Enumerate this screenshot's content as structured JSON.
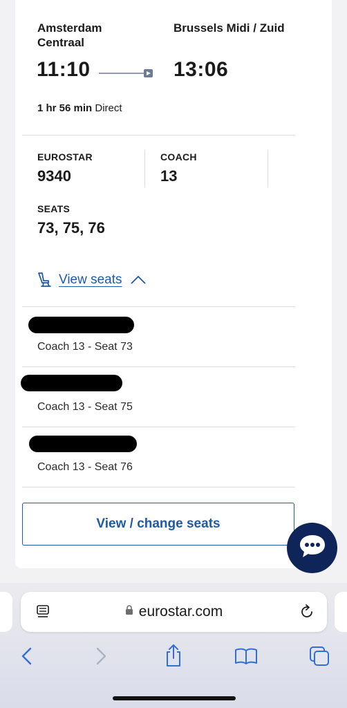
{
  "journey": {
    "origin": "Amsterdam Centraal",
    "destination": "Brussels Midi / Zuid",
    "departure_time": "11:10",
    "arrival_time": "13:06",
    "duration": "1 hr 56 min",
    "service_type": "Direct"
  },
  "train": {
    "operator_label": "EUROSTAR",
    "train_number": "9340",
    "coach_label": "COACH",
    "coach_number": "13",
    "seats_label": "SEATS",
    "seats_value": "73, 75, 76"
  },
  "view_seats": {
    "label": "View seats",
    "icon": "seat-icon",
    "expanded_icon": "chevron-up-icon"
  },
  "seat_list": [
    {
      "passenger": "[redacted]",
      "detail": "Coach 13 - Seat 73"
    },
    {
      "passenger": "[redacted]",
      "detail": "Coach 13 - Seat 75"
    },
    {
      "passenger": "[redacted]",
      "detail": "Coach 13 - Seat 76"
    }
  ],
  "change_button": {
    "label": "View / change seats"
  },
  "chat": {
    "icon": "chat-bubble-icon"
  },
  "browser": {
    "url": "eurostar.com",
    "icons": [
      "reader-icon",
      "lock-icon",
      "reload-icon",
      "back-icon",
      "forward-icon",
      "share-icon",
      "bookmarks-icon",
      "tabs-icon"
    ]
  },
  "colors": {
    "link": "#1f5aa6",
    "chat_bg": "#0f2559",
    "text": "#1b1b1b"
  }
}
